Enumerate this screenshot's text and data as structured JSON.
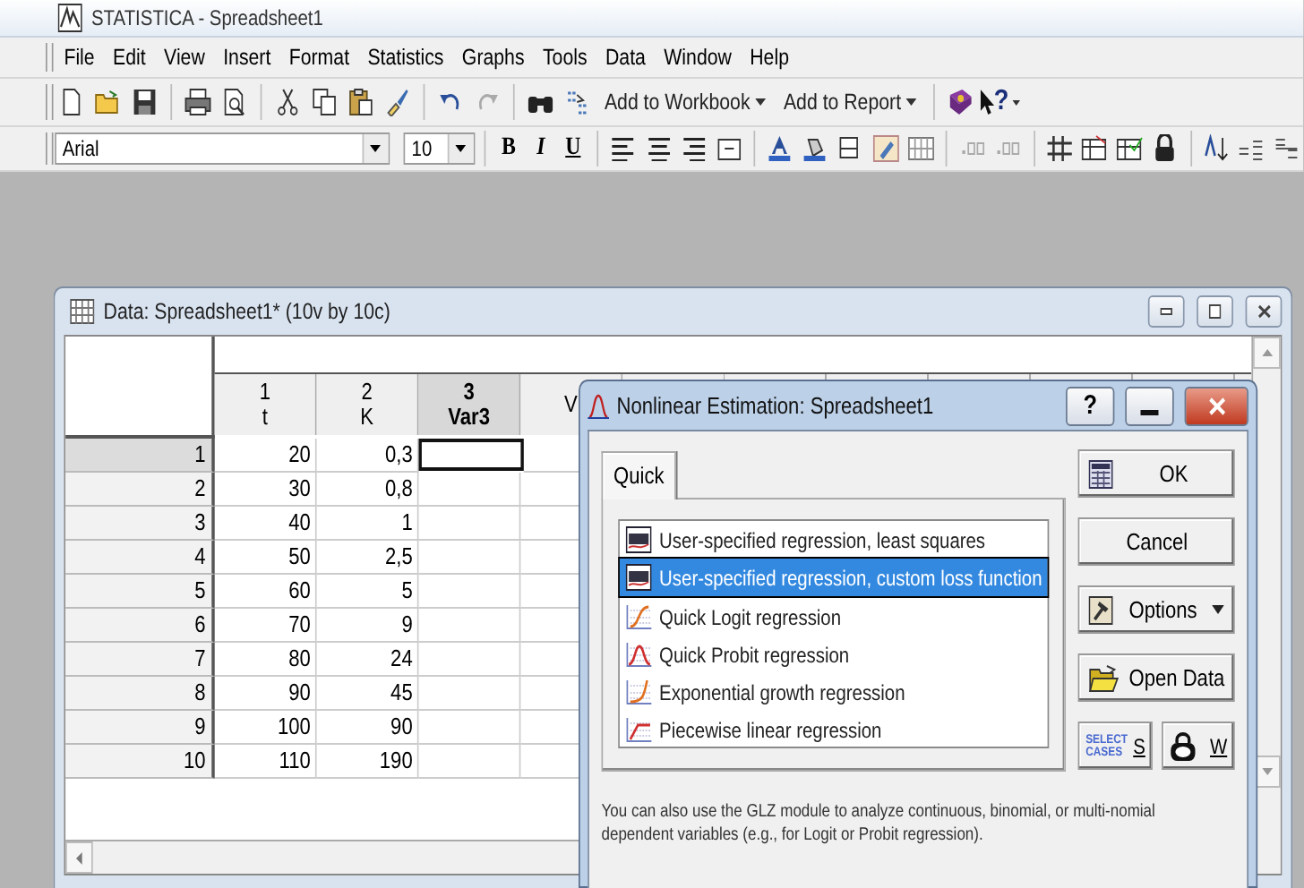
{
  "app": {
    "title": "STATISTICA - Spreadsheet1"
  },
  "menu": [
    "File",
    "Edit",
    "View",
    "Insert",
    "Format",
    "Statistics",
    "Graphs",
    "Tools",
    "Data",
    "Window",
    "Help"
  ],
  "toolbar": {
    "add_to_workbook": "Add to Workbook",
    "add_to_report": "Add to Report",
    "help": "?"
  },
  "format_bar": {
    "font": "Arial",
    "size": "10",
    "bold": "B",
    "italic": "I",
    "underline": "U"
  },
  "spreadsheet": {
    "title": "Data: Spreadsheet1* (10v by 10c)",
    "columns": [
      {
        "number": "1",
        "name": "t",
        "selected": false
      },
      {
        "number": "2",
        "name": "K",
        "selected": false
      },
      {
        "number": "3",
        "name": "Var3",
        "selected": true
      },
      {
        "name": "V",
        "selected": false
      }
    ],
    "rows": [
      {
        "label": "1",
        "selected": true,
        "values": [
          "20",
          "0,3"
        ]
      },
      {
        "label": "2",
        "selected": false,
        "values": [
          "30",
          "0,8"
        ]
      },
      {
        "label": "3",
        "selected": false,
        "values": [
          "40",
          "1"
        ]
      },
      {
        "label": "4",
        "selected": false,
        "values": [
          "50",
          "2,5"
        ]
      },
      {
        "label": "5",
        "selected": false,
        "values": [
          "60",
          "5"
        ]
      },
      {
        "label": "6",
        "selected": false,
        "values": [
          "70",
          "9"
        ]
      },
      {
        "label": "7",
        "selected": false,
        "values": [
          "80",
          "24"
        ]
      },
      {
        "label": "8",
        "selected": false,
        "values": [
          "90",
          "45"
        ]
      },
      {
        "label": "9",
        "selected": false,
        "values": [
          "100",
          "90"
        ]
      },
      {
        "label": "10",
        "selected": false,
        "values": [
          "110",
          "190"
        ]
      }
    ]
  },
  "dialog": {
    "title": "Nonlinear Estimation: Spreadsheet1",
    "help": "?",
    "tabs": [
      {
        "label": "Quick",
        "selected": true
      }
    ],
    "groups": [
      [
        {
          "kind": "user",
          "label": "User-specified regression, least squares",
          "selected": false
        },
        {
          "kind": "user",
          "label": "User-specified regression, custom loss function",
          "selected": true
        }
      ],
      [
        {
          "kind": "logit",
          "label": "Quick Logit regression",
          "selected": false
        },
        {
          "kind": "probit",
          "label": "Quick Probit regression",
          "selected": false
        },
        {
          "kind": "exponential",
          "label": "Exponential growth regression",
          "selected": false
        },
        {
          "kind": "piecewise",
          "label": "Piecewise linear regression",
          "selected": false
        }
      ]
    ],
    "buttons": [
      {
        "kind": "ok",
        "label": "OK"
      },
      {
        "kind": "plain",
        "label": "Cancel"
      },
      {
        "kind": "options",
        "label": "Options"
      },
      {
        "kind": "open",
        "label": "Open Data"
      }
    ],
    "small_buttons": [
      {
        "kind": "select",
        "badge": "SELECT CASES",
        "label": "S"
      },
      {
        "kind": "weight",
        "label": "W"
      }
    ],
    "note": "You can also use the GLZ module to analyze continuous, binomial, or multi-nomial dependent variables (e.g., for Logit or Probit regression)."
  }
}
